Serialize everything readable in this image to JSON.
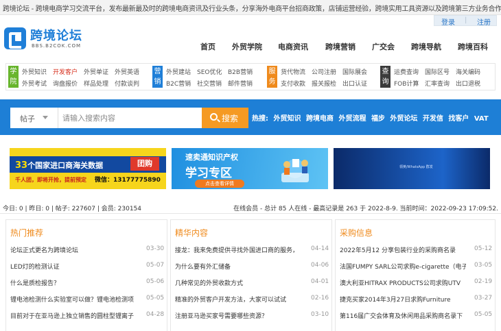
{
  "topbar": {
    "notice": "跨境论坛 - 跨境电商学习交流平台，发布最新最及时的跨境电商资讯及行业头条，分享海外电商平台招商政策，店铺运营经验，跨境实用工具资源以及跨境第三方业务合作信息。",
    "login": "登录",
    "separator": "|",
    "register": "注册"
  },
  "logo": {
    "name": "跨境论坛",
    "url": "BBS.B2COK.COM",
    "icon": "logo-b-icon",
    "color": "#1f7fd8"
  },
  "mainnav": [
    "首页",
    "外贸学院",
    "电商资讯",
    "跨境营销",
    "广交会",
    "跨境导航",
    "跨境百科"
  ],
  "categories": [
    {
      "label": "学院",
      "color": "#68b52d",
      "links": [
        "外贸知识",
        "开发客户",
        "外贸单证",
        "外贸英语",
        "外贸考试",
        "询盘报价",
        "样品处理",
        "付款谈判"
      ],
      "hot_index": 1
    },
    {
      "label": "营销",
      "color": "#1f7fd8",
      "links": [
        "外贸建站",
        "SEO优化",
        "B2B营销",
        "B2C营销",
        "社交营销",
        "邮件营销"
      ]
    },
    {
      "label": "服务",
      "color": "#ef8a1c",
      "links": [
        "货代物流",
        "公司注册",
        "国际展会",
        "支付收款",
        "报关报检",
        "出口认证"
      ]
    },
    {
      "label": "查询",
      "color": "#3b3b3b",
      "links": [
        "运费查询",
        "国际区号",
        "海关编码",
        "FOB计算",
        "汇率查询",
        "出口退税"
      ]
    }
  ],
  "search": {
    "type_selected": "帖子",
    "placeholder": "请输入搜索内容",
    "button_label": "搜索",
    "hot_label": "热搜:",
    "hot_words": [
      "外贸知识",
      "跨境电商",
      "外贸流程",
      "福步",
      "外贸论坛",
      "开发信",
      "找客户",
      "VAT"
    ],
    "accent": "#1e7fd6",
    "button_color": "#f59a23"
  },
  "banners": {
    "b1": {
      "line1_num": "33",
      "line1": "个国家进口商海关数据",
      "tag": "团购",
      "line2": "千人团，即将开抢，提前预定",
      "line3": "微信：13177775890"
    },
    "b2": {
      "line1": "速卖通知识产权",
      "line2": "学习专区",
      "pill": "点击查看详情"
    },
    "b3": {
      "text": "领英/WhatsApp 群发"
    }
  },
  "stats": {
    "left": "今日: 0 | 昨日: 0 | 帖子: 227607 | 会员: 230154",
    "right": "在线会员 - 总计 85 人在线 - 最高记录是 263 于 2022-8-9.  当前时间：2022-09-23 17:09:52."
  },
  "columns": [
    {
      "title": "热门推荐",
      "items": [
        {
          "text": "论坛正式更名为跨境论坛",
          "date": "03-30"
        },
        {
          "text": "LED灯的检测认证",
          "date": "05-07"
        },
        {
          "text": "什么是质检报告？",
          "date": "05-06"
        },
        {
          "text": "锂电池检测什么实验室可以做？锂电池检测项",
          "date": "05-05"
        },
        {
          "text": "目前对于在亚马逊上独立销售的圆柱型锂离子",
          "date": "04-28"
        }
      ]
    },
    {
      "title": "精华内容",
      "items": [
        {
          "text": "接龙：我来免费提供寻找外国进口商的服务，",
          "date": "04-14"
        },
        {
          "text": "为什么要有外汇储备",
          "date": "04-06"
        },
        {
          "text": "几种常见的外贸收款方式",
          "date": "04-01"
        },
        {
          "text": "精准的外贸客户开发方法，大家可以试试",
          "date": "02-16"
        },
        {
          "text": "注册亚马逊买家号需要哪些资源？",
          "date": "03-10"
        }
      ]
    },
    {
      "title": "采购信息",
      "items": [
        {
          "text": "2022年5月12 分享包装行业的采购商名录",
          "date": "05-12"
        },
        {
          "text": "法国FUMPY SARL公司求购e-cigarette（电子",
          "date": "03-05"
        },
        {
          "text": "澳大利亚HITRAX PRODUCTS公司求购UTV",
          "date": "02-19"
        },
        {
          "text": "捷克买家2014年3月27日求购Furniture",
          "date": "03-27"
        },
        {
          "text": "第116届广交会体育及休闲用品采购商名录下",
          "date": "05-05"
        }
      ]
    }
  ]
}
